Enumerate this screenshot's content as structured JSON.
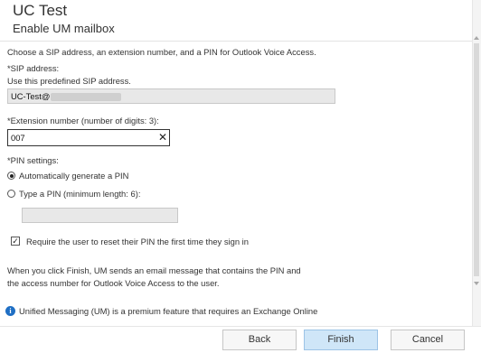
{
  "header": {
    "title": "UC Test",
    "subtitle": "Enable UM mailbox"
  },
  "intro": "Choose a SIP address, an extension number, and a PIN for Outlook Voice Access.",
  "sip": {
    "label": "*SIP address:",
    "help": "Use this predefined SIP address.",
    "value": "UC-Test@"
  },
  "extension": {
    "label": "*Extension number (number of digits: 3):",
    "value": "007",
    "clear_icon": "close-icon"
  },
  "pin": {
    "label": "*PIN settings:",
    "option_auto": "Automatically generate a PIN",
    "option_manual": "Type a PIN (minimum length: 6):",
    "selected": "auto",
    "pin_value": ""
  },
  "reset": {
    "label": "Require the user to reset their PIN the first time they sign in",
    "checked": true
  },
  "finish_note_1": "When you click Finish, UM sends an email message that contains the PIN and",
  "finish_note_2": "the access number for Outlook Voice Access to the user.",
  "info": {
    "icon": "info-icon",
    "text": "Unified Messaging (UM) is a premium feature that requires an Exchange Online"
  },
  "buttons": {
    "back": "Back",
    "finish": "Finish",
    "cancel": "Cancel"
  },
  "colors": {
    "primary_button": "#cfe6f8",
    "info_icon": "#1f6fc4"
  }
}
